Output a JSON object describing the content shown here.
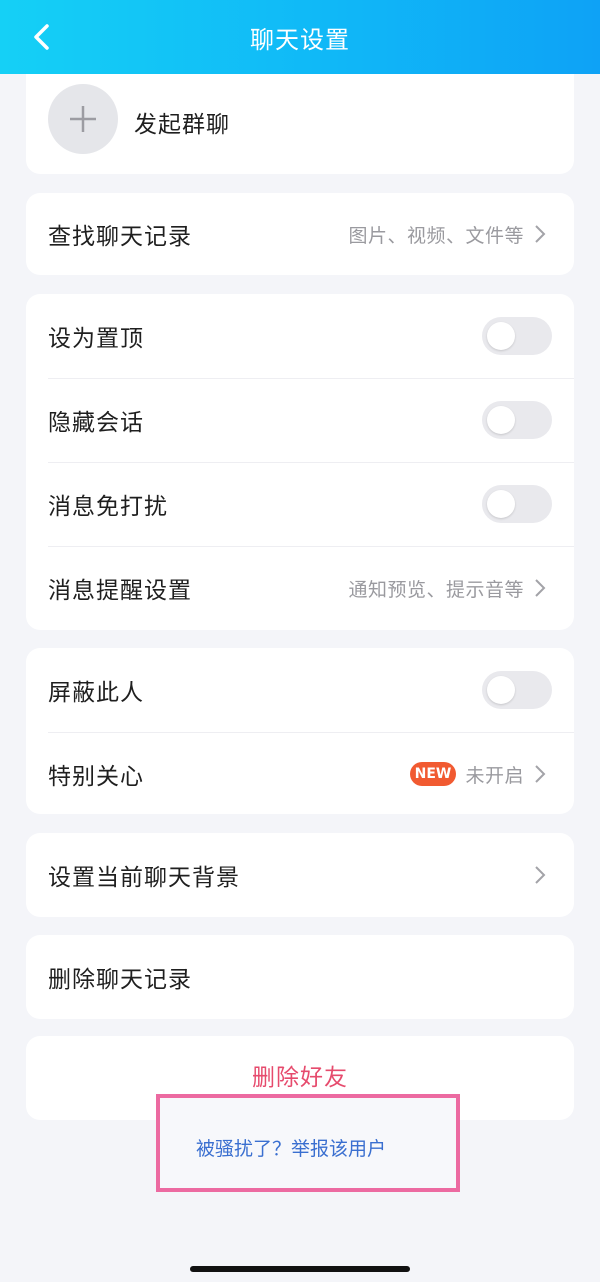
{
  "header": {
    "title": "聊天设置",
    "back_icon": "chevron-left-icon"
  },
  "group_chat": {
    "label": "发起群聊",
    "icon": "plus-icon"
  },
  "search_history": {
    "label": "查找聊天记录",
    "hint": "图片、视频、文件等"
  },
  "settings": {
    "pin": {
      "label": "设为置顶",
      "on": false
    },
    "hide": {
      "label": "隐藏会话",
      "on": false
    },
    "dnd": {
      "label": "消息免打扰",
      "on": false
    },
    "notify": {
      "label": "消息提醒设置",
      "hint": "通知预览、提示音等"
    }
  },
  "privacy": {
    "block": {
      "label": "屏蔽此人",
      "on": false
    },
    "special": {
      "label": "特别关心",
      "badge": "NEW",
      "status": "未开启"
    }
  },
  "background": {
    "label": "设置当前聊天背景"
  },
  "clear_history": {
    "label": "删除聊天记录"
  },
  "delete_friend": {
    "label": "删除好友"
  },
  "report": {
    "label": "被骚扰了？举报该用户"
  },
  "colors": {
    "header_gradient": [
      "#15d0f6",
      "#0ea2f6"
    ],
    "delete_red": "#e64b6d",
    "report_link": "#3a6fd0",
    "highlight_border": "#ec6aa1",
    "new_badge": "#f15a31"
  }
}
